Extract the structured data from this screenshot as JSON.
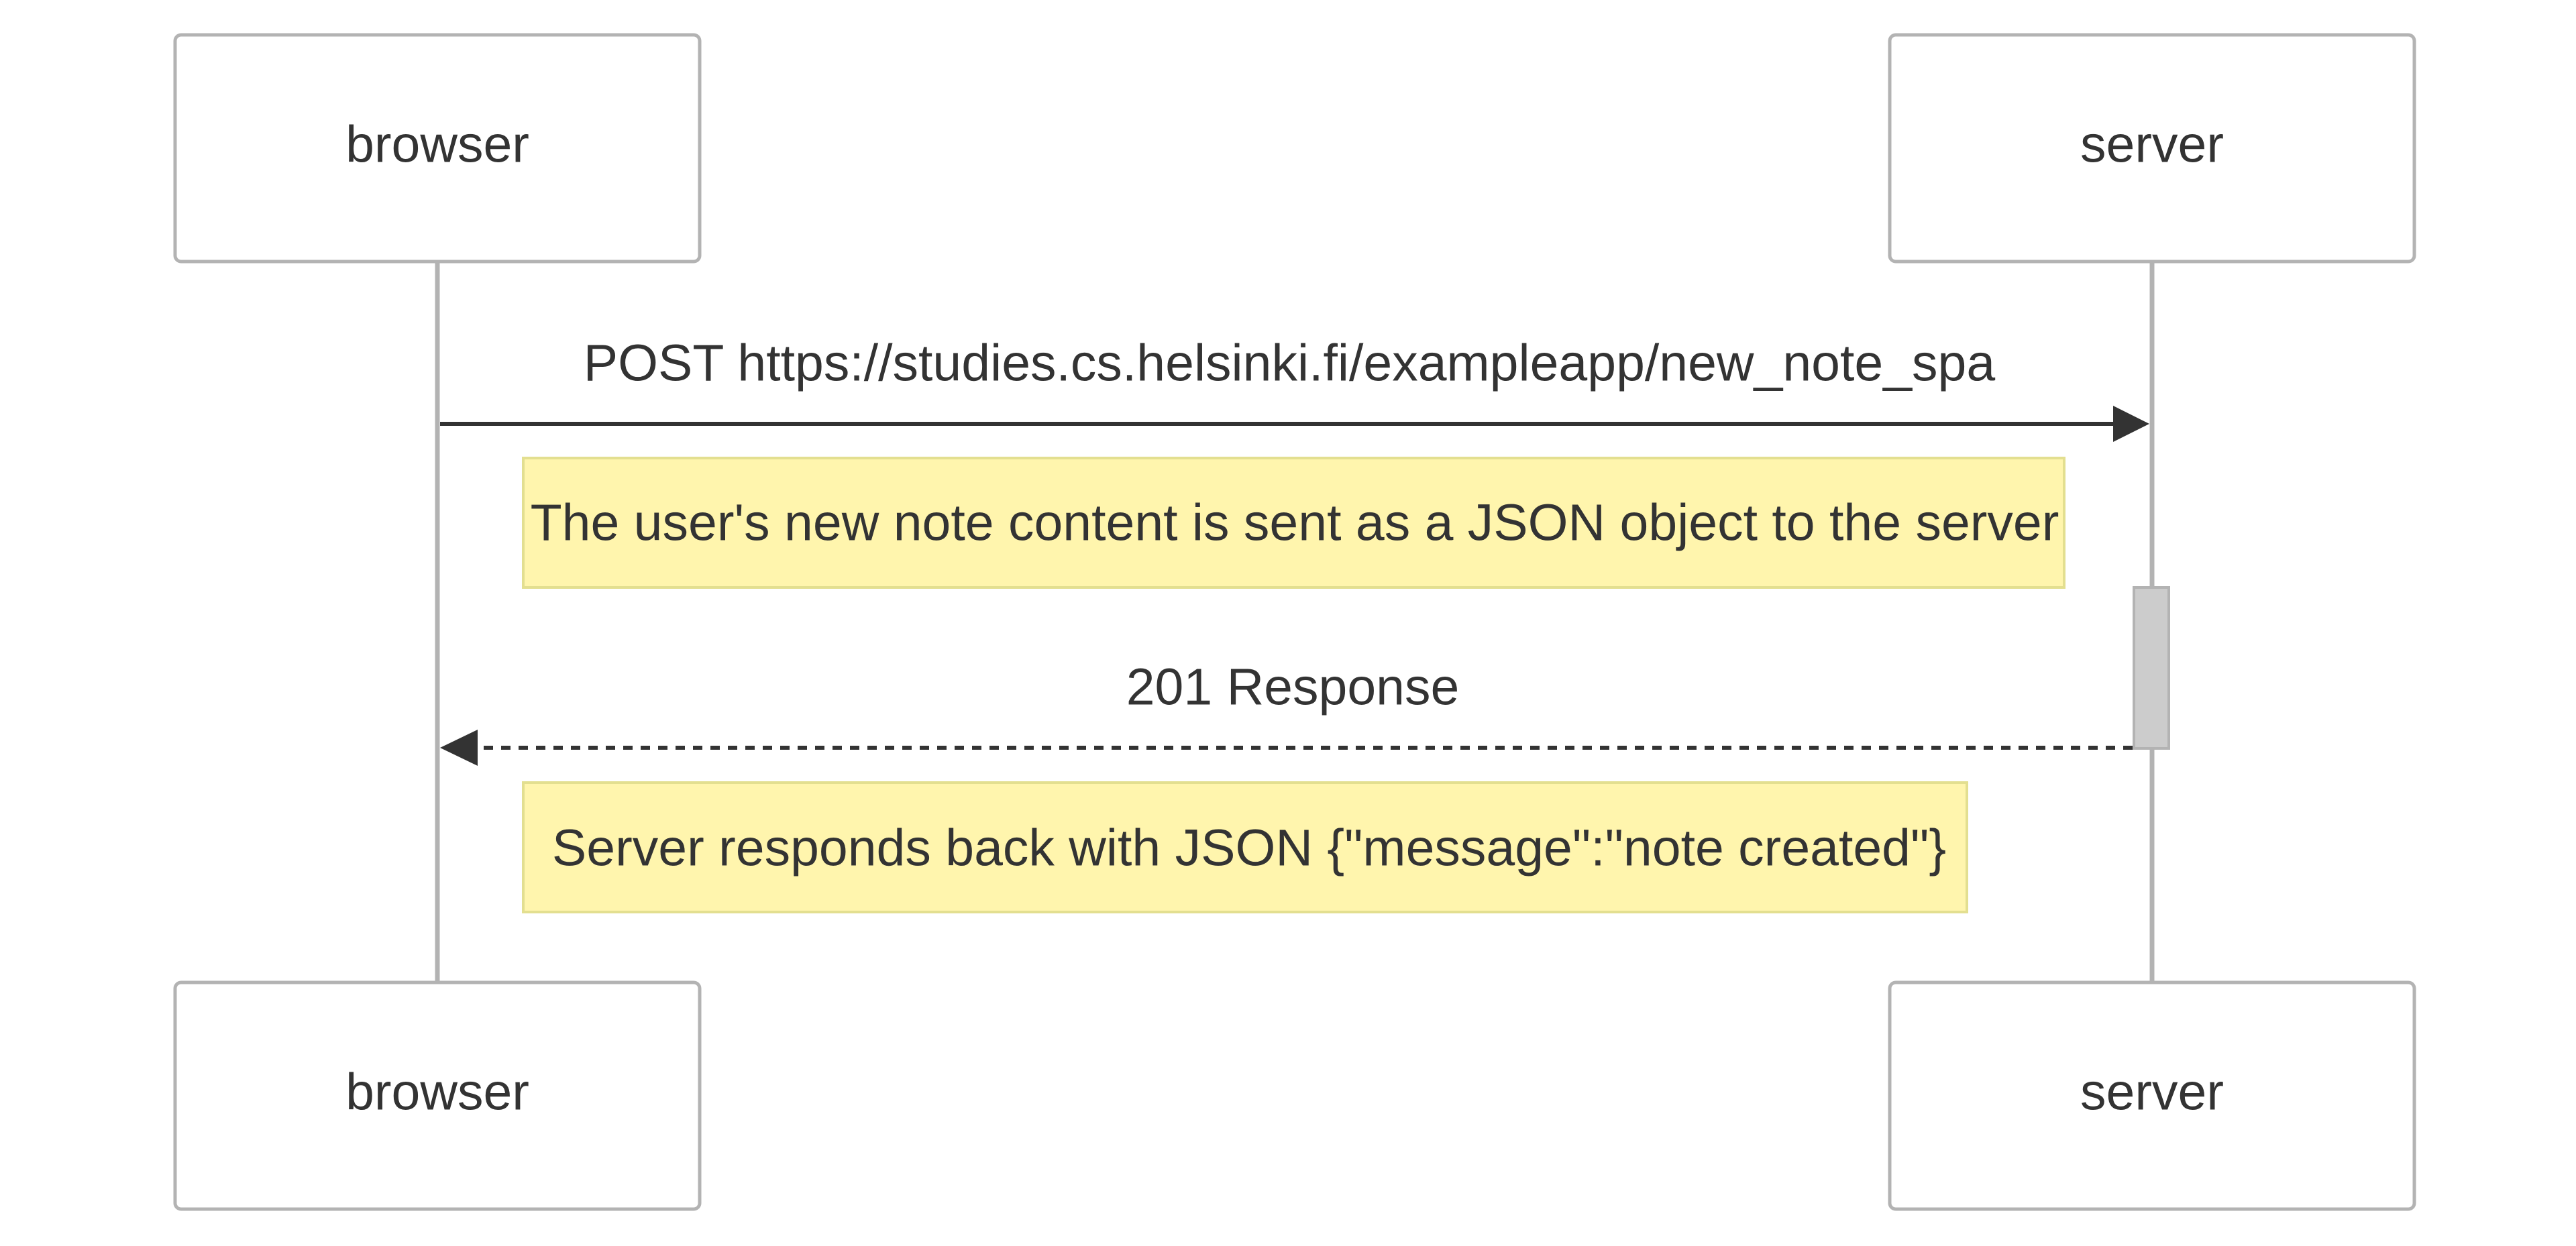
{
  "participants": {
    "browser": "browser",
    "server": "server"
  },
  "messages": [
    {
      "from": "browser",
      "to": "server",
      "label": "POST https://studies.cs.helsinki.fi/exampleapp/new_note_spa",
      "style": "solid"
    },
    {
      "from": "server",
      "to": "browser",
      "label": "201 Response",
      "style": "dashed"
    }
  ],
  "notes": [
    "The user's new note content is sent as a JSON object to the server",
    "Server responds back with JSON {\"message\":\"note created\"}"
  ],
  "colors": {
    "actor_border": "#b3b3b3",
    "text": "#333333",
    "note_fill": "#fff5ad",
    "note_border": "#e3df90",
    "activation_fill": "#cccccc"
  }
}
